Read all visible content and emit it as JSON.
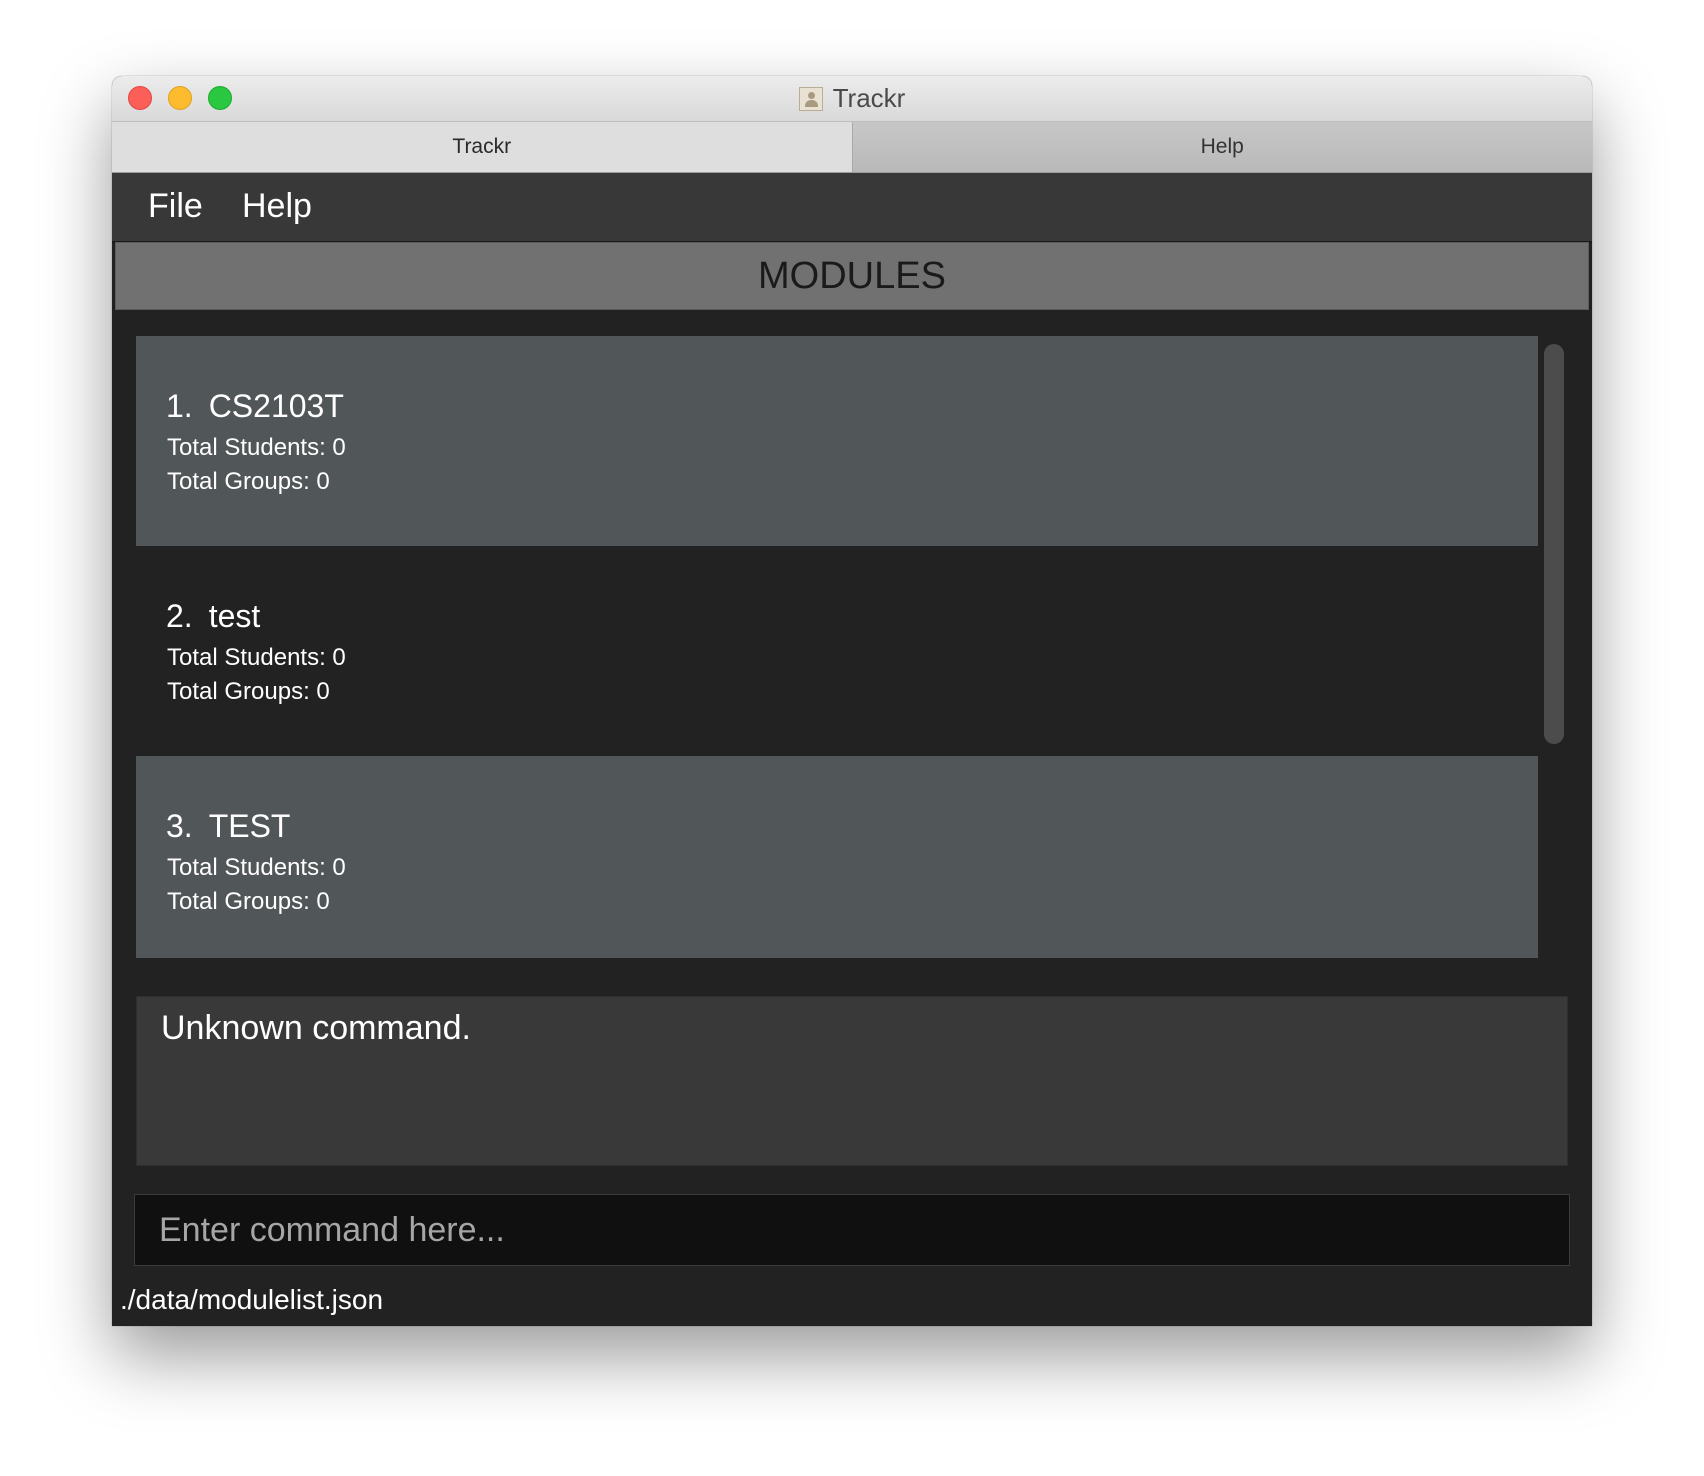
{
  "window": {
    "title": "Trackr",
    "title_icon": "app-icon"
  },
  "tabs": [
    {
      "label": "Trackr",
      "active": true
    },
    {
      "label": "Help",
      "active": false
    }
  ],
  "menu": {
    "file": "File",
    "help": "Help"
  },
  "header": {
    "title": "MODULES"
  },
  "modules": [
    {
      "index": "1.",
      "name": "CS2103T",
      "students": "Total Students: 0",
      "groups": "Total Groups: 0"
    },
    {
      "index": "2.",
      "name": "test",
      "students": "Total Students: 0",
      "groups": "Total Groups: 0"
    },
    {
      "index": "3.",
      "name": "TEST",
      "students": "Total Students: 0",
      "groups": "Total Groups: 0"
    }
  ],
  "result": {
    "text": "Unknown command."
  },
  "command": {
    "placeholder": "Enter command here...",
    "value": ""
  },
  "status": {
    "path": "./data/modulelist.json"
  },
  "colors": {
    "card_odd": "#515658",
    "card_even": "#222222",
    "header_bg": "#717171",
    "menubar_bg": "#383838"
  }
}
